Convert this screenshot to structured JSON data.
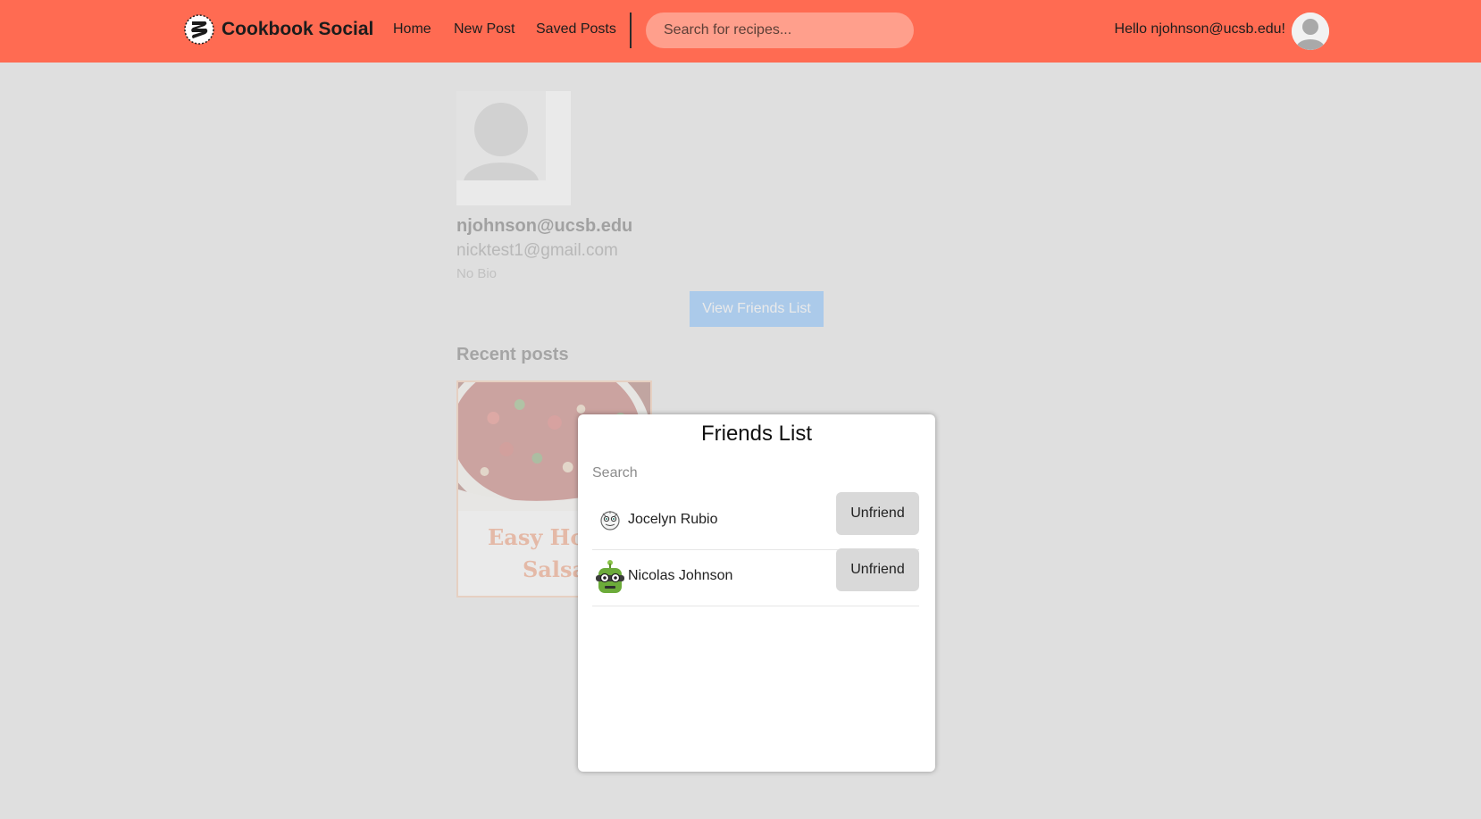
{
  "nav": {
    "brand": "Cookbook Social",
    "links": [
      "Home",
      "New Post",
      "Saved Posts"
    ],
    "search_placeholder": "Search for recipes...",
    "greeting": "Hello njohnson@ucsb.edu!",
    "accent_color": "#ff6b52"
  },
  "profile": {
    "username": "njohnson@ucsb.edu",
    "email": "nicktest1@gmail.com",
    "bio": "No Bio",
    "view_friends_label": "View Friends List",
    "recent_posts_heading": "Recent posts"
  },
  "posts": [
    {
      "title_line1": "Easy Home",
      "title_line2": "Salsa",
      "image": "salsa-bowl"
    }
  ],
  "friends_modal": {
    "title": "Friends List",
    "search_placeholder": "Search",
    "friends": [
      {
        "name": "Jocelyn Rubio",
        "avatar": "monster-avatar",
        "action": "Unfriend"
      },
      {
        "name": "Nicolas Johnson",
        "avatar": "robot-avatar",
        "action": "Unfriend"
      }
    ]
  }
}
